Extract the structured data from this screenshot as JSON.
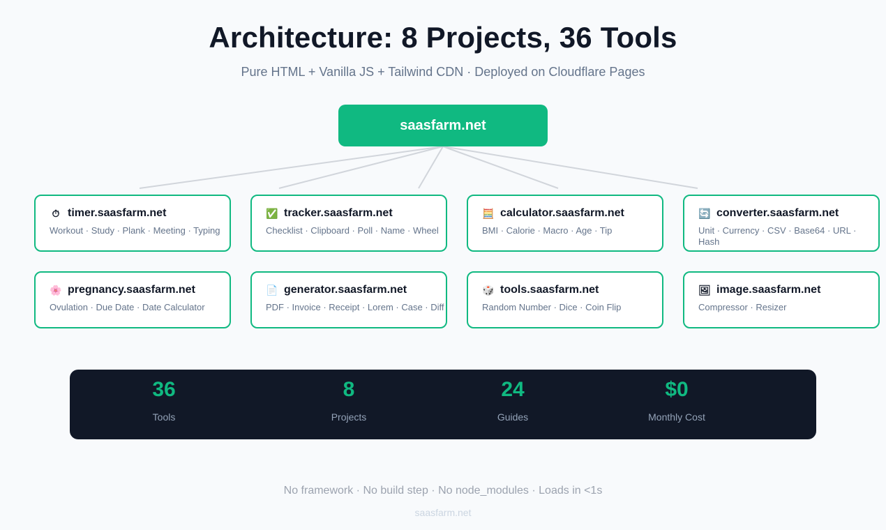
{
  "header": {
    "title": "Architecture: 8 Projects, 36 Tools",
    "subtitle": "Pure HTML + Vanilla JS + Tailwind CDN · Deployed on Cloudflare Pages"
  },
  "root": {
    "label": "saasfarm.net",
    "color": "#10b981"
  },
  "projects": [
    {
      "icon": "stopwatch-icon",
      "glyph": "⏱",
      "name": "timer.saasfarm.net",
      "tools": "Workout · Study · Plank · Meeting · Typing"
    },
    {
      "icon": "checkmark-icon",
      "glyph": "✅",
      "name": "tracker.saasfarm.net",
      "tools": "Checklist · Clipboard · Poll · Name · Wheel"
    },
    {
      "icon": "abacus-icon",
      "glyph": "🧮",
      "name": "calculator.saasfarm.net",
      "tools": "BMI · Calorie · Macro · Age · Tip"
    },
    {
      "icon": "arrows-cycle-icon",
      "glyph": "🔄",
      "name": "converter.saasfarm.net",
      "tools": "Unit · Currency · CSV · Base64 · URL · Hash"
    },
    {
      "icon": "flower-icon",
      "glyph": "🌸",
      "name": "pregnancy.saasfarm.net",
      "tools": "Ovulation · Due Date · Date Calculator"
    },
    {
      "icon": "document-icon",
      "glyph": "📄",
      "name": "generator.saasfarm.net",
      "tools": "PDF · Invoice · Receipt · Lorem · Case · Diff"
    },
    {
      "icon": "dice-icon",
      "glyph": "🎲",
      "name": "tools.saasfarm.net",
      "tools": "Random Number · Dice · Coin Flip"
    },
    {
      "icon": "picture-icon",
      "glyph": "🖼",
      "name": "image.saasfarm.net",
      "tools": "Compressor · Resizer"
    }
  ],
  "stats": [
    {
      "value": "36",
      "label": "Tools"
    },
    {
      "value": "8",
      "label": "Projects"
    },
    {
      "value": "24",
      "label": "Guides"
    },
    {
      "value": "$0",
      "label": "Monthly Cost"
    }
  ],
  "footer": {
    "note": "No framework · No build step · No node_modules · Loads in <1s",
    "domain": "saasfarm.net"
  },
  "colors": {
    "accent": "#10b981",
    "dark": "#111827",
    "muted": "#64748b",
    "connector": "#d1d5db"
  }
}
